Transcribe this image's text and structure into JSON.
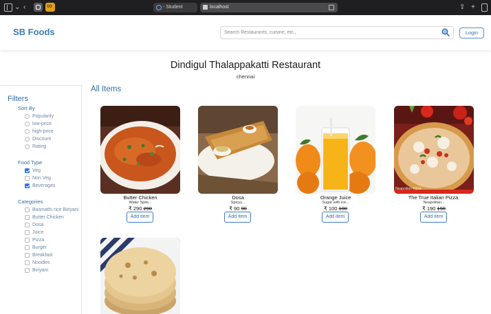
{
  "browser": {
    "tab_title": "- Student",
    "address": "localhost"
  },
  "header": {
    "brand": "SB Foods",
    "search_placeholder": "Search Restaurants, cuisine, etc.,",
    "login_label": "Login"
  },
  "restaurant": {
    "name": "Dindigul Thalappakatti Restaurant",
    "city": "chennai"
  },
  "filters": {
    "title": "Filters",
    "sort_by": {
      "title": "Sort By",
      "options": [
        "Popularity",
        "low-price",
        "high-price",
        "Discount",
        "Rating"
      ]
    },
    "food_type": {
      "title": "Food Type",
      "options": [
        {
          "label": "Veg",
          "checked": true
        },
        {
          "label": "Non Veg",
          "checked": false
        },
        {
          "label": "Beverages",
          "checked": true
        }
      ]
    },
    "categories": {
      "title": "Categories",
      "options": [
        "Basmathi rice Biriyani",
        "Butter Chicken",
        "Dosa",
        "Juice",
        "Pizza",
        "Burger",
        "Breakfast",
        "Noodles",
        "Biriyani"
      ]
    }
  },
  "main": {
    "heading": "All Items",
    "add_label": "Add item",
    "items": [
      {
        "name": "Butter Chicken",
        "desc": "Water Spits...",
        "price": "₹ 290",
        "old_price": "290"
      },
      {
        "name": "Dosa",
        "desc": "Spicyy...",
        "price": "₹ 90",
        "old_price": "90"
      },
      {
        "name": "Orange Juice",
        "desc": "Sugar with ice...",
        "price": "₹ 100",
        "old_price": "100"
      },
      {
        "name": "The True Italian Pizza:",
        "desc": "Neapolitan...",
        "price": "₹ 190",
        "old_price": "190",
        "photo_label": "Neapolitan Pizza"
      }
    ]
  },
  "colors": {
    "brand": "#3a7fb8",
    "accent": "#2f6fa0",
    "checkbox": "#2f76d8"
  }
}
